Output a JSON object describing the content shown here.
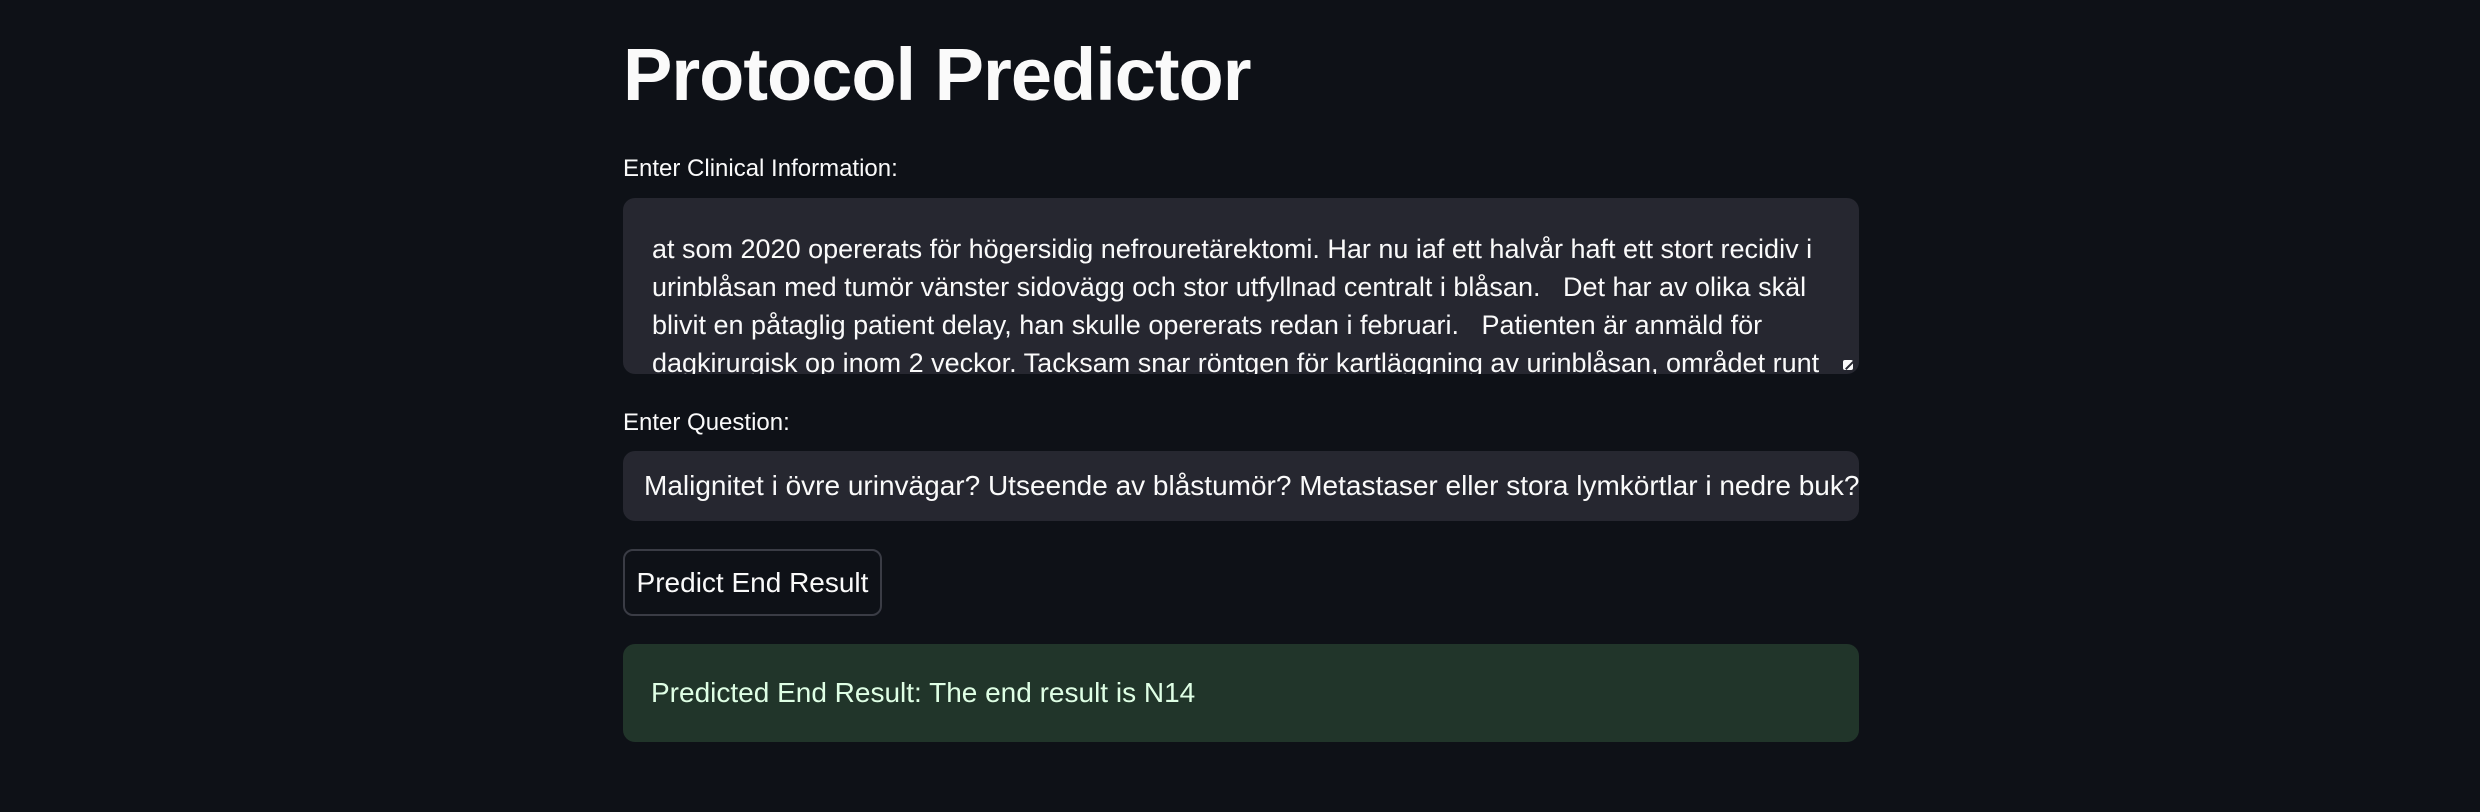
{
  "app": {
    "title": "Protocol Predictor"
  },
  "clinical_info": {
    "label": "Enter Clinical Information:",
    "value": "at som 2020 opererats för högersidig nefrouretärektomi. Har nu iaf ett halvår haft ett stort recidiv i urinblåsan med tumör vänster sidovägg och stor utfyllnad centralt i blåsan.   Det har av olika skäl blivit en påtaglig patient delay, han skulle opererats redan i februari.   Patienten är anmäld för dagkirurgisk op inom 2 veckor. Tacksam snar röntgen för kartläggning av urinblåsan, området runt"
  },
  "question": {
    "label": "Enter Question:",
    "value": "Malignitet i övre urinvägar? Utseende av blåstumör? Metastaser eller stora lymkörtlar i nedre buk?"
  },
  "predict_button": {
    "label": "Predict End Result"
  },
  "result": {
    "text": "Predicted End Result: The end result is N14"
  },
  "colors": {
    "background": "#0e1117",
    "input_background": "#262730",
    "success_background": "#21352a",
    "text": "#fafafa"
  },
  "icons": {
    "textarea_resize": "resize-handle-icon"
  }
}
